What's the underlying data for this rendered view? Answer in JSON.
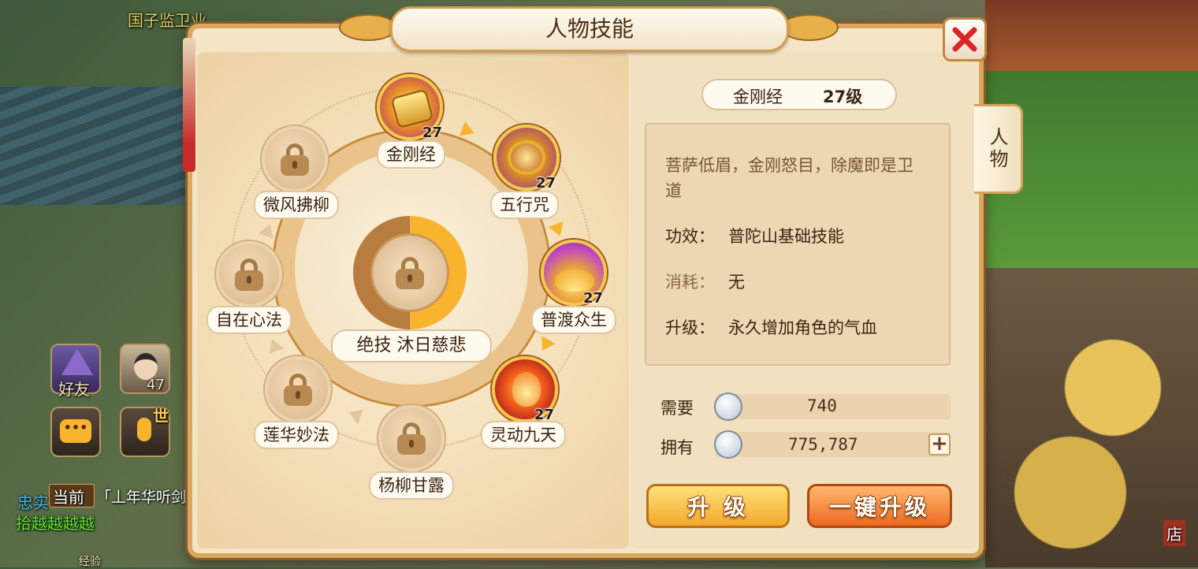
{
  "background": {
    "guild_banner": "国子监卫业",
    "friends_label": "好友",
    "player_level": "47",
    "world_badge": "世",
    "channel_label": "当前",
    "chat_line_1": "忠实",
    "chat_line_2": "拾越越越越",
    "chat_line_3": "「丄年华听剑",
    "exp_label": "经验",
    "shop_label": "店"
  },
  "window": {
    "title": "人物技能",
    "side_tab_label": "人物"
  },
  "skill_wheel": {
    "ultimate_label": "绝技  沐日慈悲",
    "nodes": [
      {
        "name": "金刚经",
        "level": "27",
        "unlocked": true,
        "icon": "golden-scroll-icon"
      },
      {
        "name": "五行咒",
        "level": "27",
        "unlocked": true,
        "icon": "five-elements-disc-icon"
      },
      {
        "name": "普渡众生",
        "level": "27",
        "unlocked": true,
        "icon": "lotus-icon"
      },
      {
        "name": "灵动九天",
        "level": "27",
        "unlocked": true,
        "icon": "fire-spirit-icon"
      },
      {
        "name": "杨柳甘露",
        "unlocked": false,
        "icon": "lock-icon"
      },
      {
        "name": "莲华妙法",
        "unlocked": false,
        "icon": "lock-icon"
      },
      {
        "name": "自在心法",
        "unlocked": false,
        "icon": "lock-icon"
      },
      {
        "name": "微风拂柳",
        "unlocked": false,
        "icon": "lock-icon"
      }
    ]
  },
  "detail": {
    "skill_name": "金刚经",
    "skill_level": "27级",
    "description": "菩萨低眉，金刚怒目，除魔即是卫道",
    "effect_label": "功效：",
    "effect_value": "普陀山基础技能",
    "cost_label": "消耗：",
    "cost_value": "无",
    "upgrade_label": "升级：",
    "upgrade_value": "永久增加角色的气血"
  },
  "cost": {
    "required_label": "需要",
    "required_value": "740",
    "owned_label": "拥有",
    "owned_value": "775,787",
    "currency_icon": "silver-coin-icon"
  },
  "buttons": {
    "upgrade": "升 级",
    "upgrade_all": "一键升级"
  },
  "colors": {
    "accent_gold": "#f7b42c",
    "close_red": "#d8262a"
  }
}
